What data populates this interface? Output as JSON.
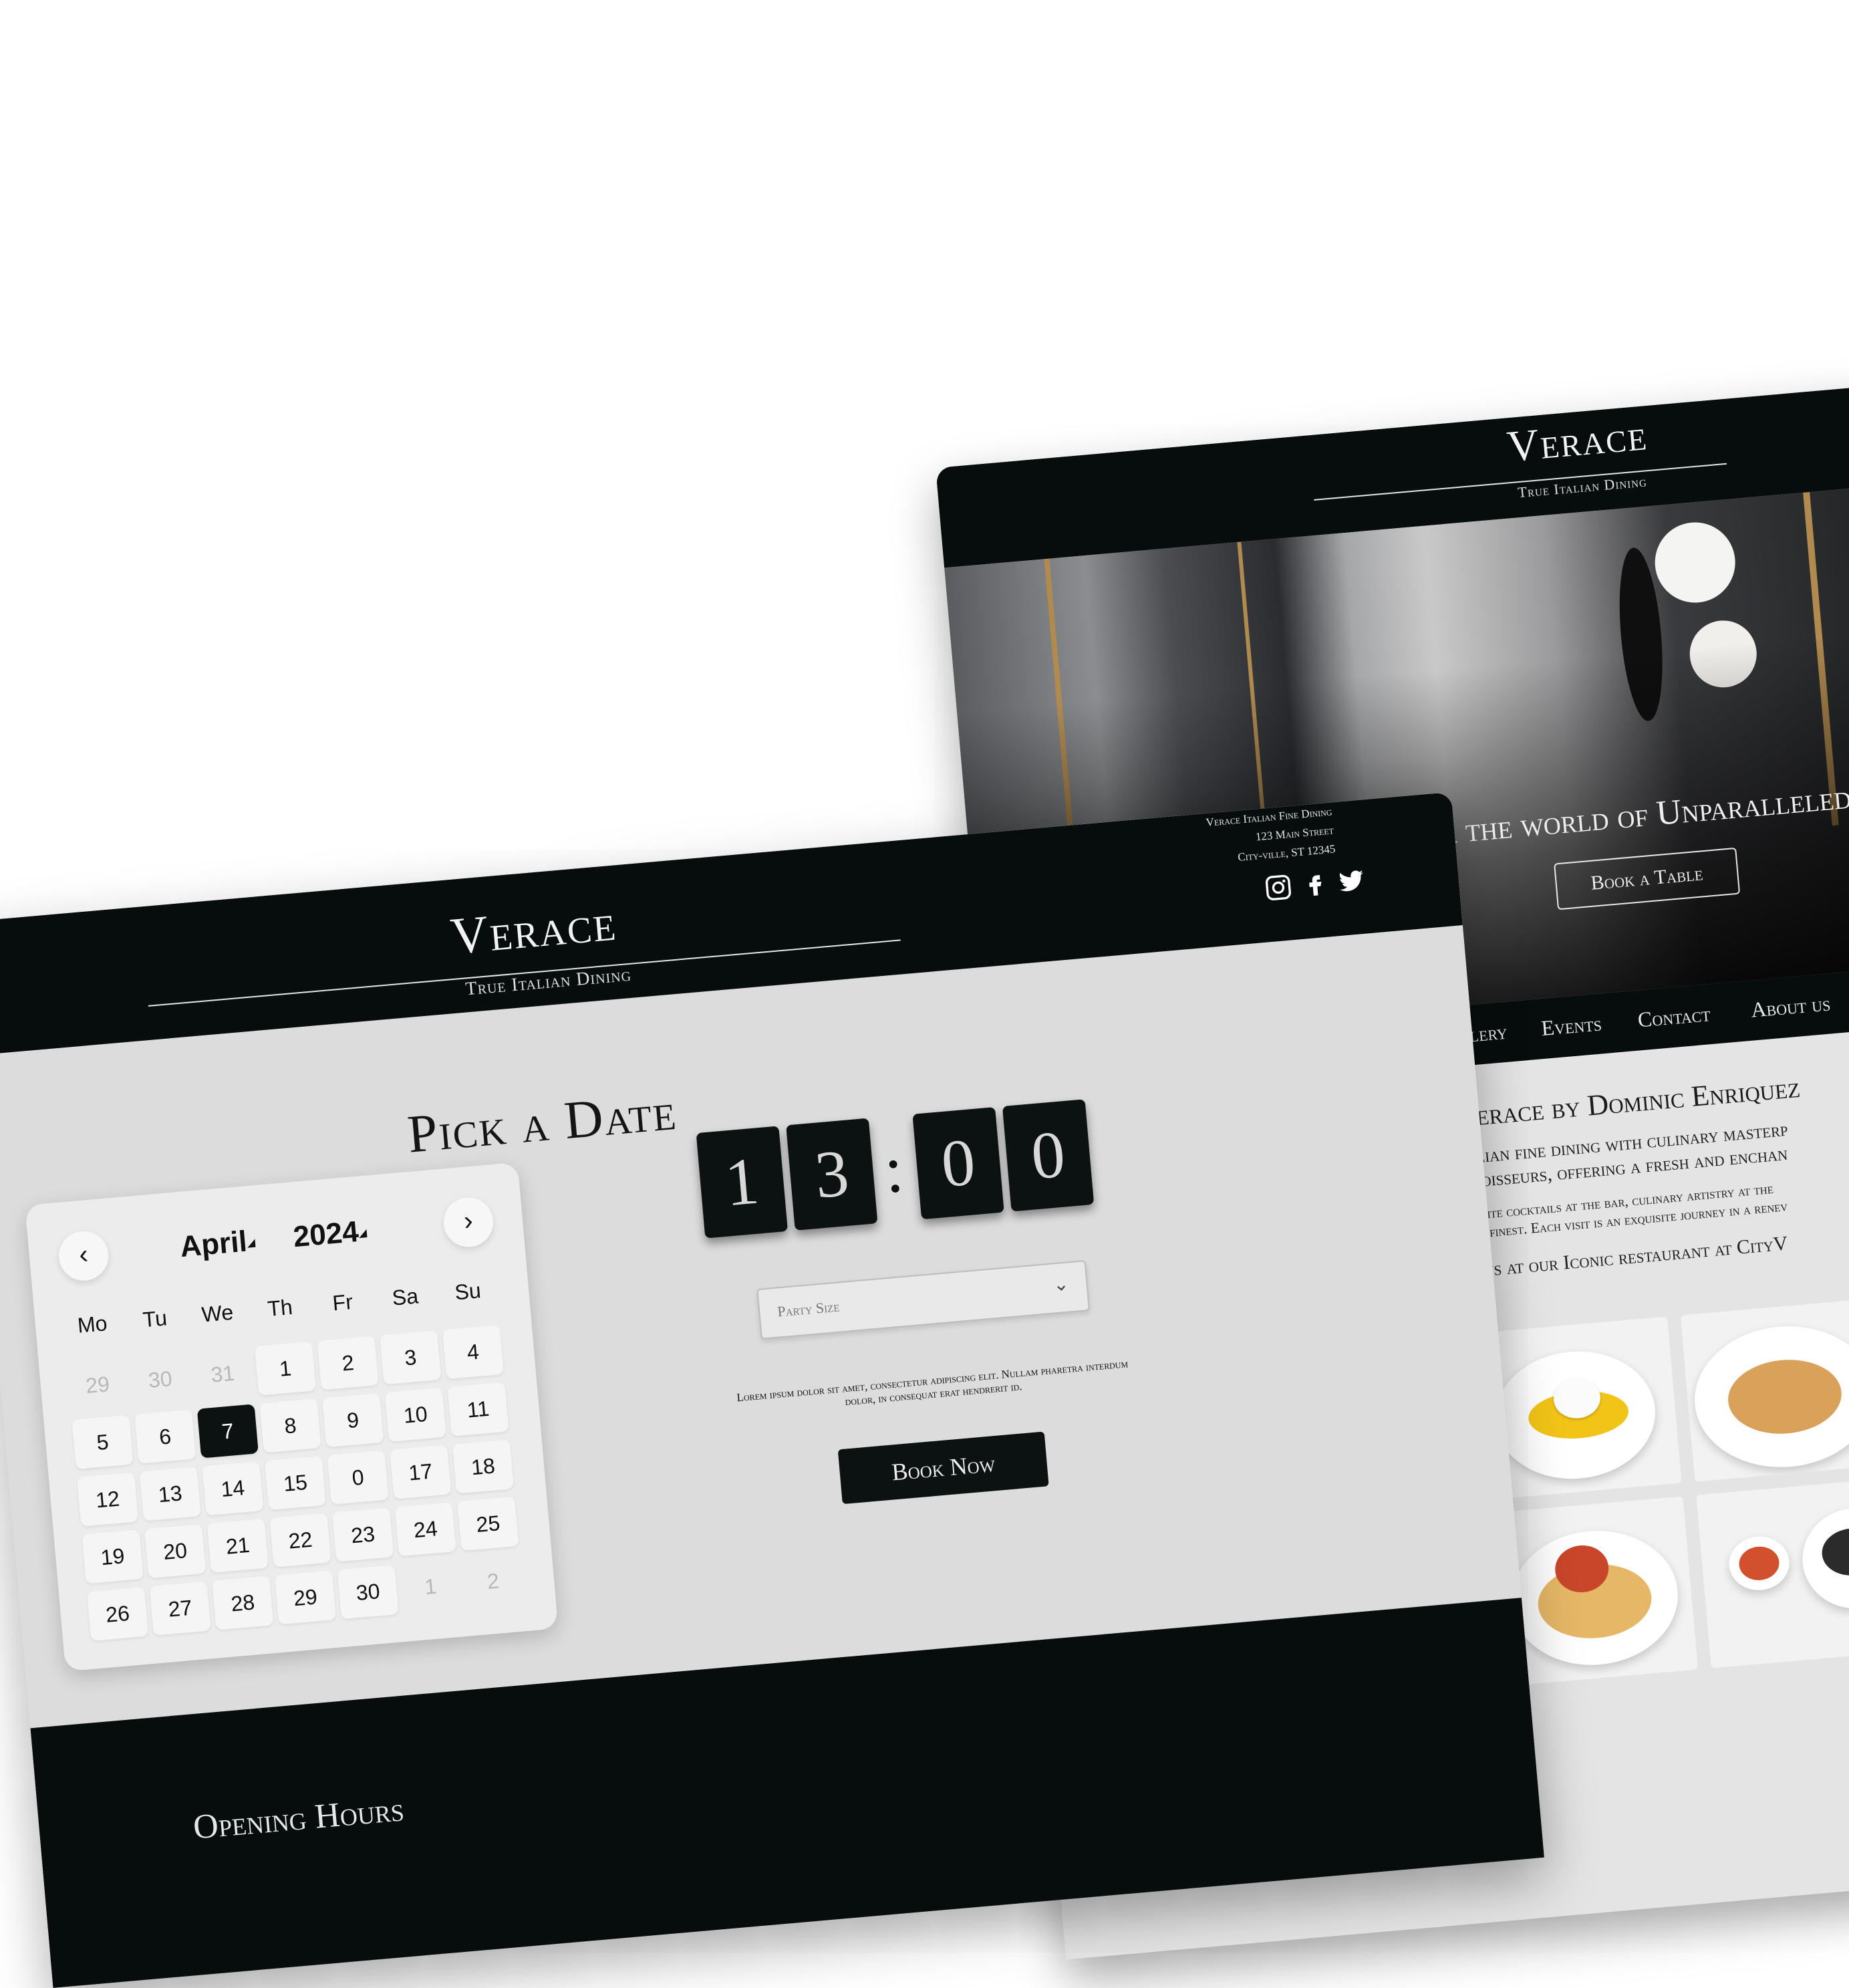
{
  "brand": {
    "name": "Verace",
    "tagline": "True Italian Dining"
  },
  "home": {
    "hero_heading": "Discover the world of Unparalleled",
    "hero_button": "Book a Table",
    "nav": [
      "Gallery",
      "Events",
      "Contact",
      "About us"
    ],
    "about_title": "Verace by Dominic Enriquez",
    "about_lines": [
      "talian fine dining with culinary masterp",
      "nnoisseurs, offering a fresh and enchan",
      "quisite cocktails at the bar, culinary artistry at the",
      "ly's finest. Each visit is an exquisite journey in a renev",
      "n us at our Iconic restaurant at CityV"
    ]
  },
  "booking": {
    "address": [
      "Verace Italian Fine Dining",
      "123 Main Street",
      "City-ville, ST 12345"
    ],
    "social": [
      "instagram-icon",
      "facebook-icon",
      "twitter-icon"
    ],
    "title": "Pick a Date",
    "calendar": {
      "month": "April",
      "year": "2024",
      "weekdays": [
        "Mo",
        "Tu",
        "We",
        "Th",
        "Fr",
        "Sa",
        "Su"
      ],
      "days": [
        [
          "29",
          "30",
          "31",
          "1",
          "2",
          "3",
          "4"
        ],
        [
          "5",
          "6",
          "7",
          "8",
          "9",
          "10",
          "11"
        ],
        [
          "12",
          "13",
          "14",
          "15",
          "0",
          "17",
          "18"
        ],
        [
          "19",
          "20",
          "21",
          "22",
          "23",
          "24",
          "25"
        ],
        [
          "26",
          "27",
          "28",
          "29",
          "30",
          "1",
          "2"
        ]
      ],
      "selected_day": "7"
    },
    "time_digits": [
      "1",
      "3",
      "0",
      "0"
    ],
    "time_separator": ":",
    "party_placeholder": "Party Size",
    "lorem": "Lorem ipsum dolor sit amet, consectetur adipiscing elit. Nullam pharetra interdum dolor, in consequat erat hendrerit id.",
    "book_button": "Book Now",
    "footer_heading": "Opening Hours"
  }
}
